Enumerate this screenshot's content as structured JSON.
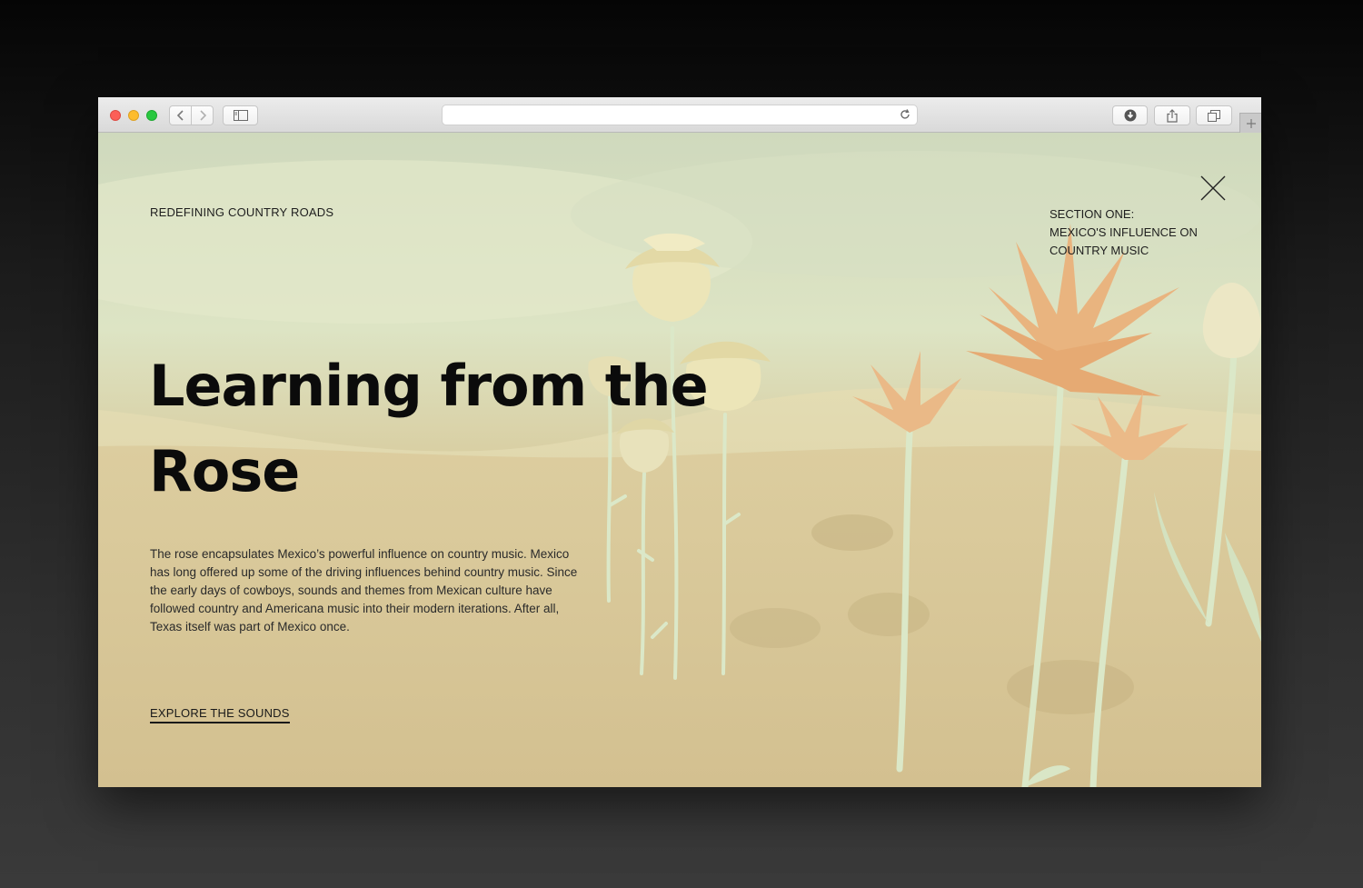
{
  "browser": {
    "address_value": "",
    "icons": [
      "back-icon",
      "forward-icon",
      "sidebar-icon",
      "reload-icon",
      "download-icon",
      "share-icon",
      "tabs-icon",
      "plus-icon"
    ]
  },
  "page": {
    "eyebrow": "REDEFINING COUNTRY ROADS",
    "section_label": {
      "line1": "SECTION ONE:",
      "line2": "MEXICO'S INFLUENCE ON",
      "line3": "COUNTRY MUSIC"
    },
    "headline_line1": "Learning from the",
    "headline_line2": "Rose",
    "body": "The rose encapsulates Mexico’s powerful influence on country music. Mexico has long offered up some of the driving influences behind country music. Since the early days of cowboys, sounds and themes from Mexican culture have followed country and Americana music into their modern iterations. After all, Texas itself was part of Mexico once.",
    "cta_label": "EXPLORE THE SOUNDS",
    "close_icon": "close-icon"
  },
  "colors": {
    "sky": "#dde4c4",
    "sand": "#d7c595",
    "rose": "#ece5b8",
    "stem": "#dbe8c8",
    "flower": "#e8b47e",
    "text": "#0b0b0b"
  }
}
